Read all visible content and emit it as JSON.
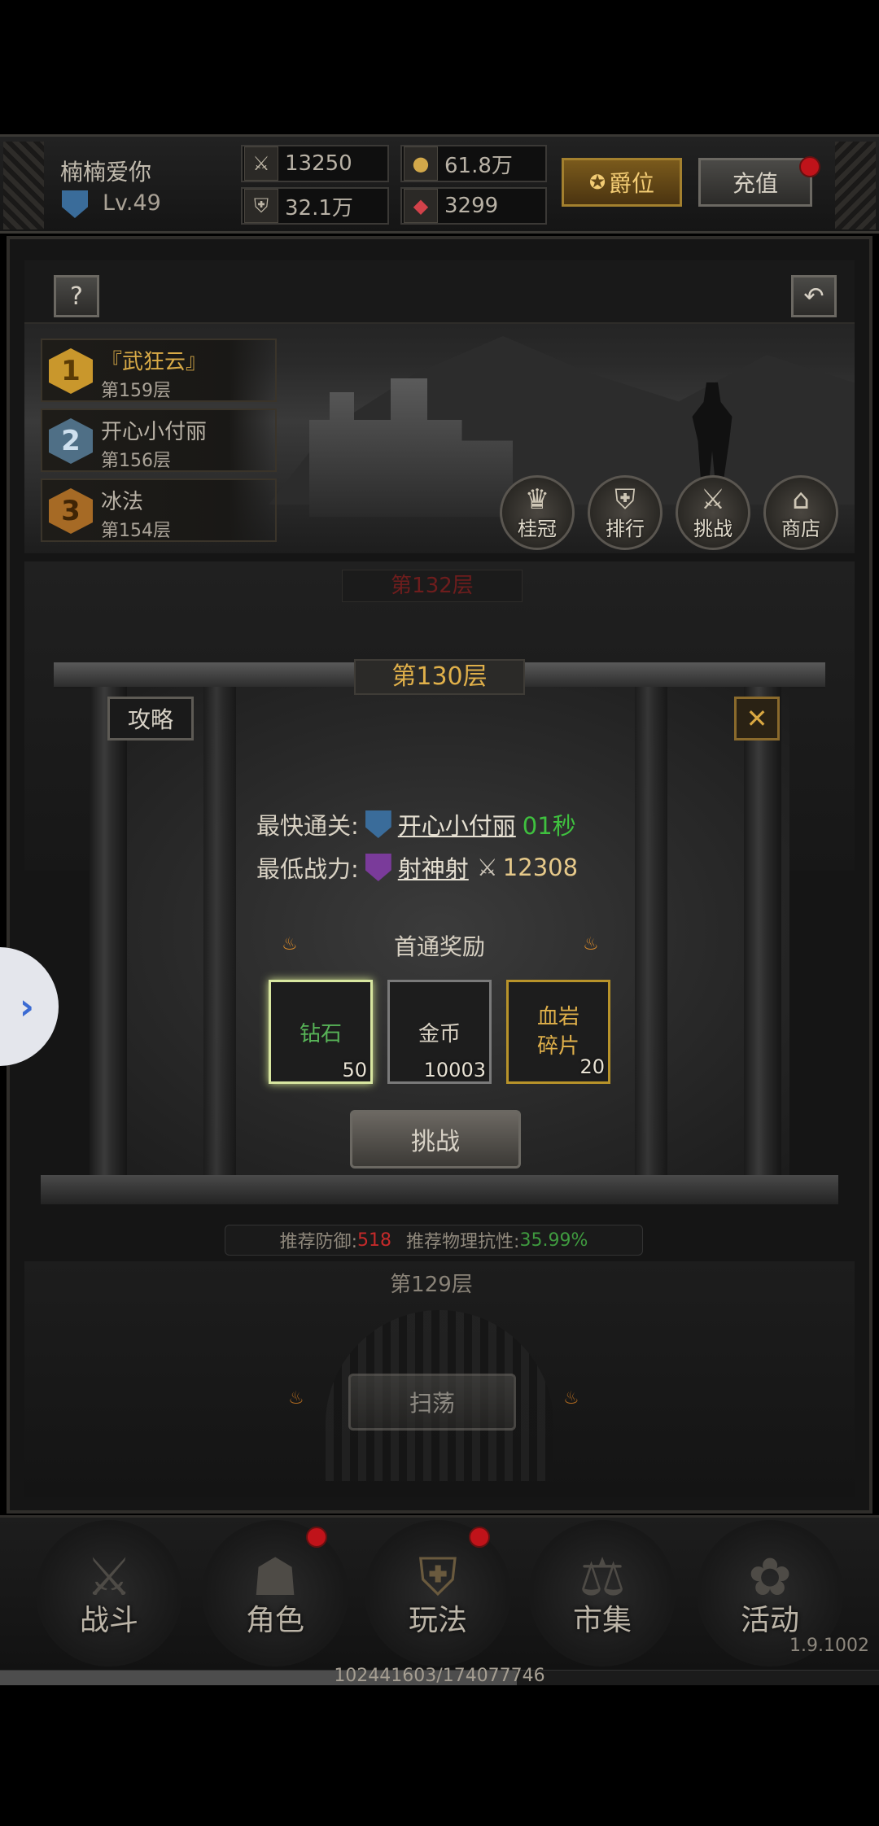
{
  "header": {
    "player_name": "楠楠爱你",
    "level": "Lv.49",
    "stats": {
      "attack": "13250",
      "defense": "32.1万",
      "gold": "61.8万",
      "gems": "3299"
    },
    "rank_button": "爵位",
    "recharge_button": "充值"
  },
  "tower": {
    "help_label": "?",
    "leaderboard": [
      {
        "rank": "1",
        "name": "『武狂云』",
        "floor": "第159层",
        "color": "#d2a84a"
      },
      {
        "rank": "2",
        "name": "开心小付丽",
        "floor": "第156层",
        "color": "#6c8fa6"
      },
      {
        "rank": "3",
        "name": "冰法",
        "floor": "第154层",
        "color": "#b3742a"
      }
    ],
    "actions": [
      {
        "label": "桂冠",
        "icon": "crown-icon"
      },
      {
        "label": "排行",
        "icon": "shield-icon"
      },
      {
        "label": "挑战",
        "icon": "crossed-swords-icon"
      },
      {
        "label": "商店",
        "icon": "temple-icon"
      }
    ],
    "upper_floor": "第132层",
    "lower_floor": "第129层",
    "sweep_button": "扫荡"
  },
  "modal": {
    "title": "第130层",
    "guide_button": "攻略",
    "close_label": "✕",
    "fastest_label": "最快通关:",
    "fastest_player": "开心小付丽",
    "fastest_time": "01秒",
    "lowest_label": "最低战力:",
    "lowest_player": "射神射",
    "lowest_power": "12308",
    "rewards_title": "首通奖励",
    "rewards": [
      {
        "name": "钻石",
        "count": "50"
      },
      {
        "name": "金币",
        "count": "10003"
      },
      {
        "name": "血岩\n碎片",
        "count": "20"
      }
    ],
    "challenge_button": "挑战",
    "recommend_defense_label": "推荐防御:",
    "recommend_defense_value": "518",
    "recommend_resist_label": "推荐物理抗性:",
    "recommend_resist_value": "35.99%"
  },
  "bottom_nav": [
    {
      "label": "战斗"
    },
    {
      "label": "角色"
    },
    {
      "label": "玩法"
    },
    {
      "label": "市集"
    },
    {
      "label": "活动"
    }
  ],
  "footer": {
    "version": "1.9.1002",
    "progress_text": "102441603/174077746",
    "progress_fraction": 0.588
  },
  "colors": {
    "gold": "#e0b04a",
    "green": "#3fc13f",
    "red": "#c42a2a"
  }
}
